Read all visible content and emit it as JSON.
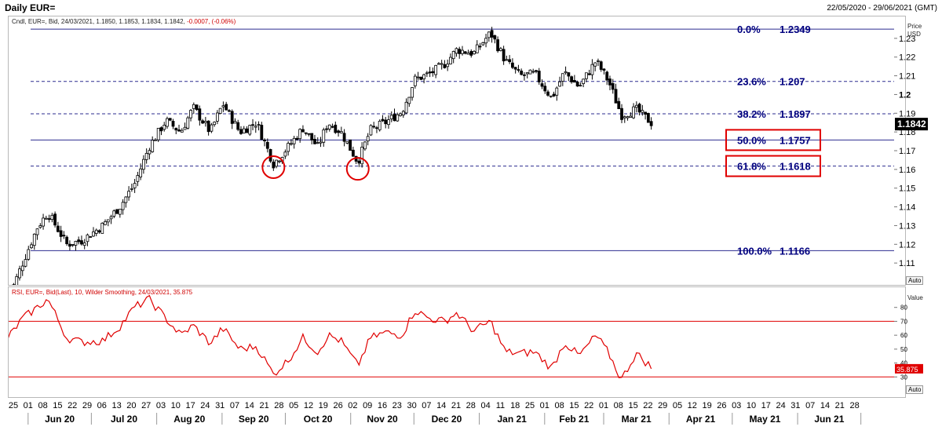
{
  "header": {
    "title": "Daily EUR=",
    "date_range": "22/05/2020 - 29/06/2021 (GMT)"
  },
  "main_panel": {
    "legend_prefix": "Cndl, EUR=, Bid, 24/03/2021, 1.1850, 1.1853, 1.1834, 1.1842,",
    "legend_change": "-0.0007, (-0.06%)",
    "axis_title_1": "Price",
    "axis_title_2": "USD",
    "auto_label": "Auto",
    "last_price_label": "1.1842"
  },
  "rsi_panel": {
    "legend": "RSI, EUR=, Bid(Last), 10, Wilder Smoothing, 24/03/2021, 35.875",
    "axis_title": "Value",
    "auto_label": "Auto",
    "last_value_label": "35.875"
  },
  "colors": {
    "candle": "#000000",
    "fib_line": "#2b2b8f",
    "fib_text": "#00007f",
    "rsi_line": "#e00000",
    "highlight": "#e00000"
  },
  "chart_data": [
    {
      "type": "candlestick",
      "title": "Daily EUR=",
      "ylabel": "Price USD",
      "ylim": [
        1.1,
        1.24
      ],
      "y_ticks": [
        1.11,
        1.12,
        1.13,
        1.14,
        1.15,
        1.16,
        1.17,
        1.18,
        1.19,
        1.2,
        1.21,
        1.22,
        1.23
      ],
      "y_tick_labels": [
        "1.11",
        "1.12",
        "1.13",
        "1.14",
        "1.15",
        "1.16",
        "1.17",
        "1.18",
        "1.19",
        "1.2",
        "1.21",
        "1.22",
        "1.23"
      ],
      "x_day_labels": [
        "25",
        "01",
        "08",
        "15",
        "22",
        "29",
        "06",
        "13",
        "20",
        "27",
        "03",
        "10",
        "17",
        "24",
        "31",
        "07",
        "14",
        "21",
        "28",
        "05",
        "12",
        "19",
        "26",
        "02",
        "09",
        "16",
        "23",
        "30",
        "07",
        "14",
        "21",
        "28",
        "04",
        "11",
        "18",
        "25",
        "01",
        "08",
        "15",
        "22",
        "01",
        "08",
        "15",
        "22",
        "29",
        "05",
        "12",
        "19",
        "26",
        "03",
        "10",
        "17",
        "24",
        "31",
        "07",
        "14",
        "21",
        "28"
      ],
      "x_month_labels": [
        "Jun 20",
        "Jul 20",
        "Aug 20",
        "Sep 20",
        "Oct 20",
        "Nov 20",
        "Dec 20",
        "Jan 21",
        "Feb 21",
        "Mar 21",
        "Apr 21",
        "May 21",
        "Jun 21"
      ],
      "fibonacci_levels": [
        {
          "level": "0.0%",
          "value": 1.2349,
          "value_label": "1.2349",
          "style": "solid",
          "highlighted": false
        },
        {
          "level": "23.6%",
          "value": 1.207,
          "value_label": "1.207",
          "style": "dashed",
          "highlighted": false
        },
        {
          "level": "38.2%",
          "value": 1.1897,
          "value_label": "1.1897",
          "style": "dashed",
          "highlighted": false
        },
        {
          "level": "50.0%",
          "value": 1.1757,
          "value_label": "1.1757",
          "style": "solid",
          "highlighted": true
        },
        {
          "level": "61.8%",
          "value": 1.1618,
          "value_label": "1.1618",
          "style": "dashed",
          "highlighted": true
        },
        {
          "level": "100.0%",
          "value": 1.1166,
          "value_label": "1.1166",
          "style": "solid",
          "highlighted": false
        }
      ],
      "last_value": 1.1842,
      "marked_lows": [
        {
          "date": "2020-09-25",
          "value": 1.1612
        },
        {
          "date": "2020-11-04",
          "value": 1.1603
        }
      ],
      "close_path": [
        [
          "2020-05-22",
          1.09
        ],
        [
          "2020-05-29",
          1.11
        ],
        [
          "2020-06-05",
          1.129
        ],
        [
          "2020-06-10",
          1.137
        ],
        [
          "2020-06-19",
          1.12
        ],
        [
          "2020-06-26",
          1.122
        ],
        [
          "2020-07-06",
          1.13
        ],
        [
          "2020-07-14",
          1.14
        ],
        [
          "2020-07-21",
          1.152
        ],
        [
          "2020-07-28",
          1.172
        ],
        [
          "2020-08-05",
          1.186
        ],
        [
          "2020-08-12",
          1.18
        ],
        [
          "2020-08-18",
          1.193
        ],
        [
          "2020-08-26",
          1.18
        ],
        [
          "2020-09-01",
          1.195
        ],
        [
          "2020-09-09",
          1.18
        ],
        [
          "2020-09-17",
          1.185
        ],
        [
          "2020-09-25",
          1.163
        ],
        [
          "2020-10-02",
          1.172
        ],
        [
          "2020-10-09",
          1.182
        ],
        [
          "2020-10-16",
          1.172
        ],
        [
          "2020-10-21",
          1.185
        ],
        [
          "2020-10-27",
          1.18
        ],
        [
          "2020-11-04",
          1.164
        ],
        [
          "2020-11-10",
          1.181
        ],
        [
          "2020-11-17",
          1.185
        ],
        [
          "2020-11-25",
          1.191
        ],
        [
          "2020-12-01",
          1.208
        ],
        [
          "2020-12-08",
          1.211
        ],
        [
          "2020-12-15",
          1.216
        ],
        [
          "2020-12-21",
          1.224
        ],
        [
          "2020-12-29",
          1.222
        ],
        [
          "2021-01-06",
          1.233
        ],
        [
          "2021-01-13",
          1.218
        ],
        [
          "2021-01-20",
          1.21
        ],
        [
          "2021-01-27",
          1.211
        ],
        [
          "2021-02-04",
          1.198
        ],
        [
          "2021-02-10",
          1.212
        ],
        [
          "2021-02-17",
          1.204
        ],
        [
          "2021-02-25",
          1.218
        ],
        [
          "2021-03-03",
          1.207
        ],
        [
          "2021-03-09",
          1.189
        ],
        [
          "2021-03-16",
          1.192
        ],
        [
          "2021-03-24",
          1.1842
        ]
      ]
    },
    {
      "type": "line",
      "title": "RSI, EUR=, Bid(Last), 10, Wilder Smoothing",
      "ylabel": "Value",
      "ylim": [
        20,
        90
      ],
      "y_ticks": [
        30,
        40,
        50,
        60,
        70,
        80
      ],
      "y_tick_labels": [
        "30",
        "40",
        "50",
        "60",
        "70",
        "80"
      ],
      "reference_lines": [
        70,
        30
      ],
      "last_value": 35.875,
      "series": [
        {
          "values_by_date": [
            [
              "2020-05-22",
              58
            ],
            [
              "2020-05-29",
              72
            ],
            [
              "2020-06-05",
              80
            ],
            [
              "2020-06-10",
              86
            ],
            [
              "2020-06-19",
              58
            ],
            [
              "2020-06-26",
              55
            ],
            [
              "2020-07-06",
              56
            ],
            [
              "2020-07-14",
              66
            ],
            [
              "2020-07-21",
              80
            ],
            [
              "2020-07-28",
              86
            ],
            [
              "2020-08-05",
              72
            ],
            [
              "2020-08-12",
              60
            ],
            [
              "2020-08-18",
              67
            ],
            [
              "2020-08-26",
              54
            ],
            [
              "2020-09-01",
              65
            ],
            [
              "2020-09-09",
              50
            ],
            [
              "2020-09-17",
              52
            ],
            [
              "2020-09-25",
              32
            ],
            [
              "2020-10-02",
              42
            ],
            [
              "2020-10-09",
              58
            ],
            [
              "2020-10-16",
              48
            ],
            [
              "2020-10-21",
              60
            ],
            [
              "2020-10-27",
              56
            ],
            [
              "2020-11-04",
              38
            ],
            [
              "2020-11-10",
              58
            ],
            [
              "2020-11-17",
              62
            ],
            [
              "2020-11-25",
              60
            ],
            [
              "2020-12-01",
              78
            ],
            [
              "2020-12-08",
              72
            ],
            [
              "2020-12-15",
              70
            ],
            [
              "2020-12-21",
              76
            ],
            [
              "2020-12-29",
              63
            ],
            [
              "2021-01-06",
              70
            ],
            [
              "2021-01-13",
              48
            ],
            [
              "2021-01-20",
              47
            ],
            [
              "2021-01-27",
              48
            ],
            [
              "2021-02-04",
              36
            ],
            [
              "2021-02-10",
              55
            ],
            [
              "2021-02-17",
              45
            ],
            [
              "2021-02-25",
              60
            ],
            [
              "2021-03-03",
              47
            ],
            [
              "2021-03-09",
              28
            ],
            [
              "2021-03-16",
              47
            ],
            [
              "2021-03-24",
              35.875
            ]
          ]
        }
      ]
    }
  ]
}
